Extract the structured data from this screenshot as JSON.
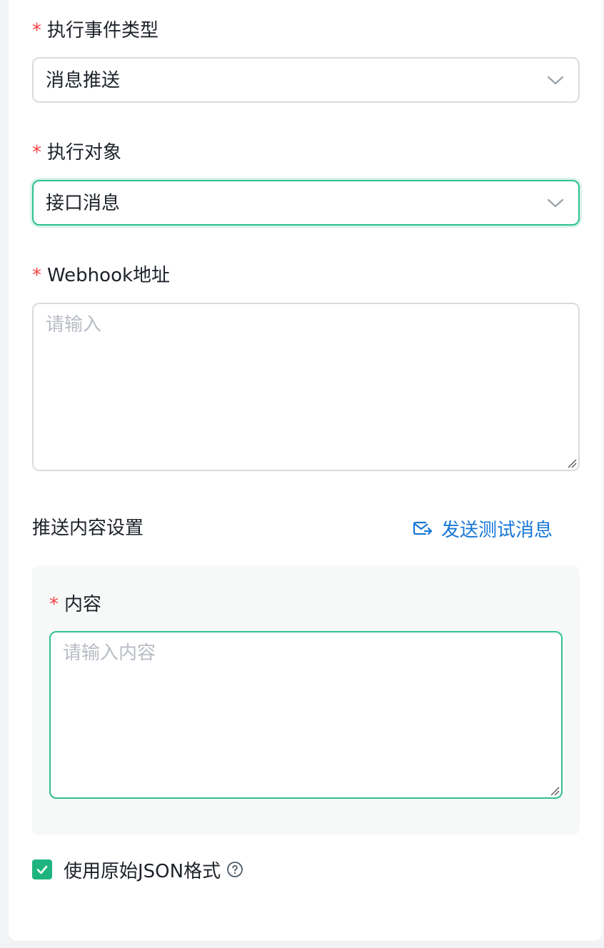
{
  "form": {
    "event_type": {
      "required_mark": "*",
      "label": "执行事件类型",
      "value": "消息推送"
    },
    "target": {
      "required_mark": "*",
      "label": "执行对象",
      "value": "接口消息"
    },
    "webhook": {
      "required_mark": "*",
      "label": "Webhook地址",
      "placeholder": "请输入"
    }
  },
  "push_settings": {
    "title": "推送内容设置",
    "send_test_label": "发送测试消息",
    "content": {
      "required_mark": "*",
      "label": "内容",
      "placeholder": "请输入内容"
    }
  },
  "raw_json": {
    "checked": true,
    "label": "使用原始JSON格式"
  },
  "colors": {
    "accent": "#1fb47f",
    "focus_border": "#2ec28a",
    "link": "#1677d8",
    "required": "#f53f3f"
  },
  "icons": {
    "select_arrow": "chevron-down-icon",
    "send_test": "mail-send-icon",
    "help": "question-circle-icon",
    "check": "check-icon",
    "resize": "resize-grip-icon"
  }
}
